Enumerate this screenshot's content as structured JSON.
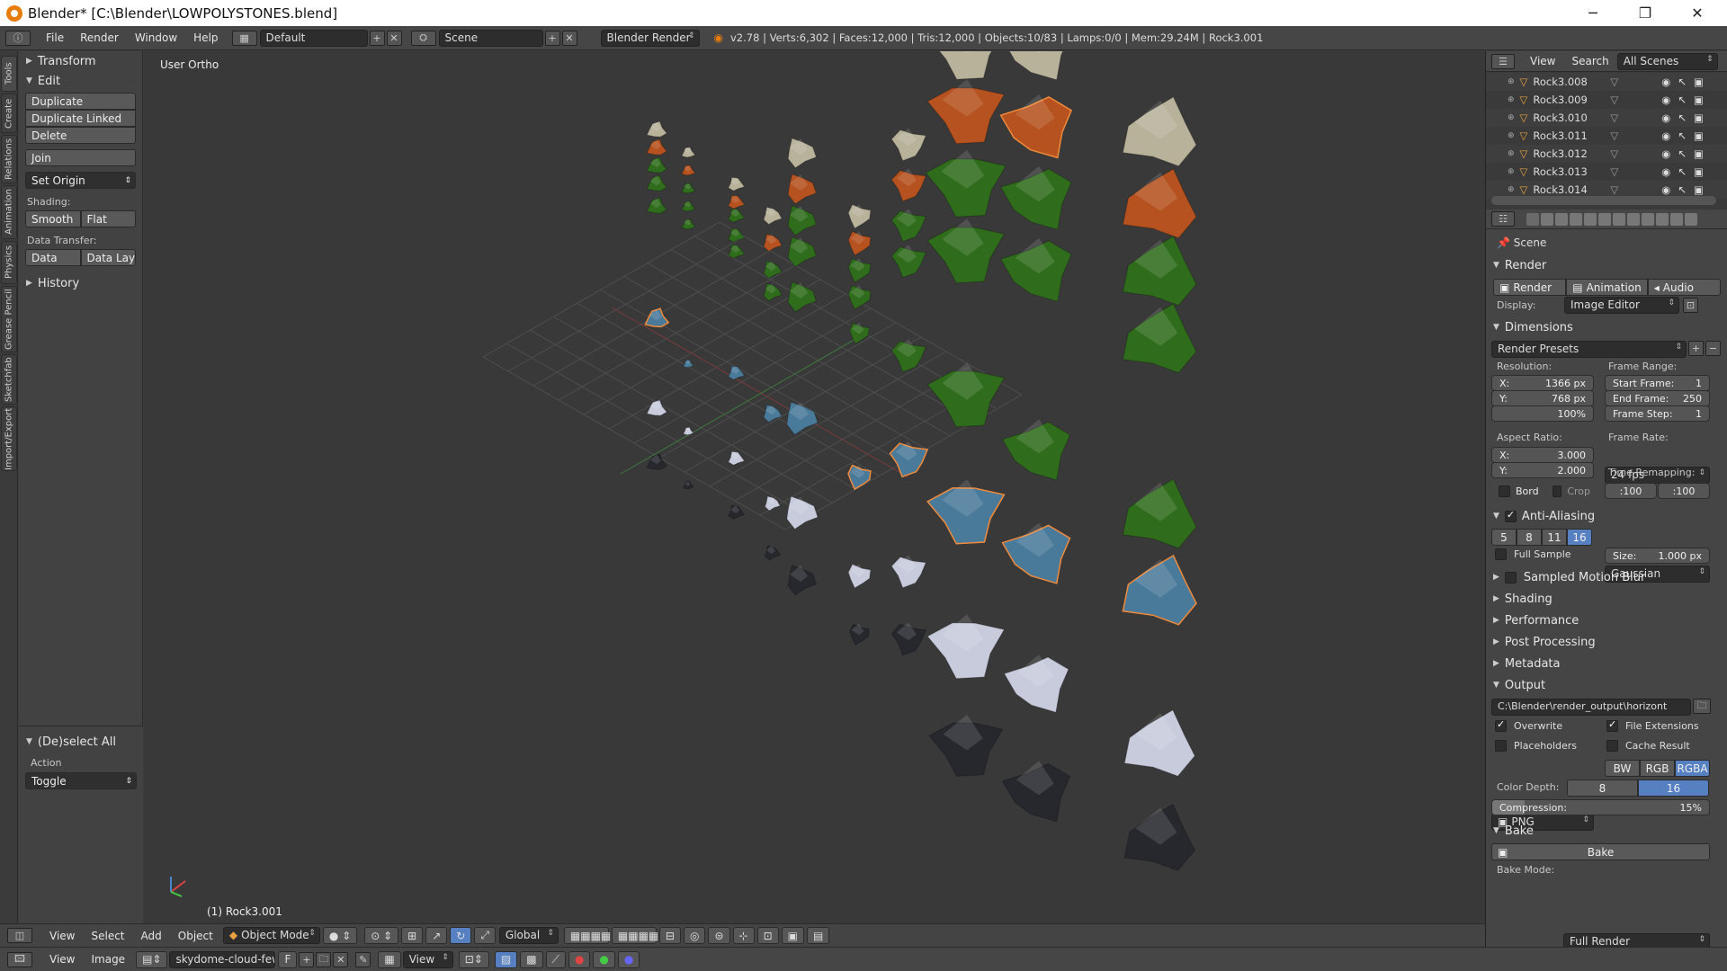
{
  "window": {
    "title": "Blender* [C:\\Blender\\LOWPOLYSTONES.blend]",
    "minimize": "─",
    "maximize": "❐",
    "close": "✕"
  },
  "infobar": {
    "menus": [
      "File",
      "Render",
      "Window",
      "Help"
    ],
    "layout": "Default",
    "scene": "Scene",
    "engine": "Blender Render",
    "stats": "v2.78 | Verts:6,302 | Faces:12,000 | Tris:12,000 | Objects:10/83 | Lamps:0/0 | Mem:29.24M | Rock3.001"
  },
  "left_tabs": [
    "Tools",
    "Create",
    "Relations",
    "Animation",
    "Physics",
    "Grease Pencil",
    "Sketchfab",
    "Import/Export"
  ],
  "toolshelf": {
    "transform": "Transform",
    "edit": "Edit",
    "duplicate": "Duplicate",
    "duplicate_linked": "Duplicate Linked",
    "delete": "Delete",
    "join": "Join",
    "set_origin": "Set Origin",
    "shading_label": "Shading:",
    "smooth": "Smooth",
    "flat": "Flat",
    "data_transfer_label": "Data Transfer:",
    "data": "Data",
    "data_layo": "Data Layo",
    "history": "History",
    "operator_title": "(De)select All",
    "action_label": "Action",
    "action_value": "Toggle"
  },
  "viewport": {
    "view_name": "User Ortho",
    "active_object": "(1) Rock3.001"
  },
  "outliner": {
    "view": "View",
    "search": "Search",
    "scenes": "All Scenes",
    "items": [
      "Rock3.008",
      "Rock3.009",
      "Rock3.010",
      "Rock3.011",
      "Rock3.012",
      "Rock3.013",
      "Rock3.014"
    ]
  },
  "properties": {
    "context": "Scene",
    "render_title": "Render",
    "render_btn": "Render",
    "animation_btn": "Animation",
    "audio_btn": "Audio",
    "display_label": "Display:",
    "display_value": "Image Editor",
    "dimensions_title": "Dimensions",
    "render_presets": "Render Presets",
    "resolution_label": "Resolution:",
    "res_x": "X:",
    "res_x_val": "1366 px",
    "res_y": "Y:",
    "res_y_val": "768 px",
    "res_pct": "100%",
    "frame_range_label": "Frame Range:",
    "start_frame": "Start Frame:",
    "start_val": "1",
    "end_frame": "End Frame:",
    "end_val": "250",
    "frame_step": "Frame Step:",
    "step_val": "1",
    "aspect_label": "Aspect Ratio:",
    "asp_x": "X:",
    "asp_x_val": "3.000",
    "asp_y": "Y:",
    "asp_y_val": "2.000",
    "frame_rate_label": "Frame Rate:",
    "fps": "24 fps",
    "time_remap_label": "Time Remapping:",
    "remap_old": ":100",
    "remap_new": ":100",
    "bord": "Bord",
    "crop": "Crop",
    "aa_title": "Anti-Aliasing",
    "aa_samples": [
      "5",
      "8",
      "11",
      "16"
    ],
    "aa_filter": "Gaussian",
    "full_sample": "Full Sample",
    "size": "Size:",
    "size_val": "1.000 px",
    "smb": "Sampled Motion Blur",
    "shading": "Shading",
    "performance": "Performance",
    "post": "Post Processing",
    "metadata": "Metadata",
    "output_title": "Output",
    "output_path": "C:\\Blender\\render_output\\horizont",
    "overwrite": "Overwrite",
    "file_ext": "File Extensions",
    "placeholders": "Placeholders",
    "cache_result": "Cache Result",
    "format": "PNG",
    "bw": "BW",
    "rgb": "RGB",
    "rgba": "RGBA",
    "color_depth_label": "Color Depth:",
    "depth8": "8",
    "depth16": "16",
    "compression": "Compression:",
    "compression_val": "15%",
    "bake_title": "Bake",
    "bake_btn": "Bake",
    "bake_mode_label": "Bake Mode:",
    "bake_mode": "Full Render"
  },
  "header3d": {
    "view": "View",
    "select": "Select",
    "add": "Add",
    "object": "Object",
    "mode": "Object Mode",
    "orientation": "Global"
  },
  "footer": {
    "view": "View",
    "image": "Image",
    "image_name": "skydome-cloud-few-...",
    "f": "F",
    "view2": "View"
  },
  "colors": {
    "accent": "#5680c2",
    "selected": "#f08a3a",
    "rock_green": "#2f6d1c",
    "rock_orange": "#b5521f",
    "rock_blue": "#4a7a99",
    "rock_beige": "#b8b29a",
    "rock_white": "#c7cbdc",
    "rock_dark": "#26282e"
  }
}
